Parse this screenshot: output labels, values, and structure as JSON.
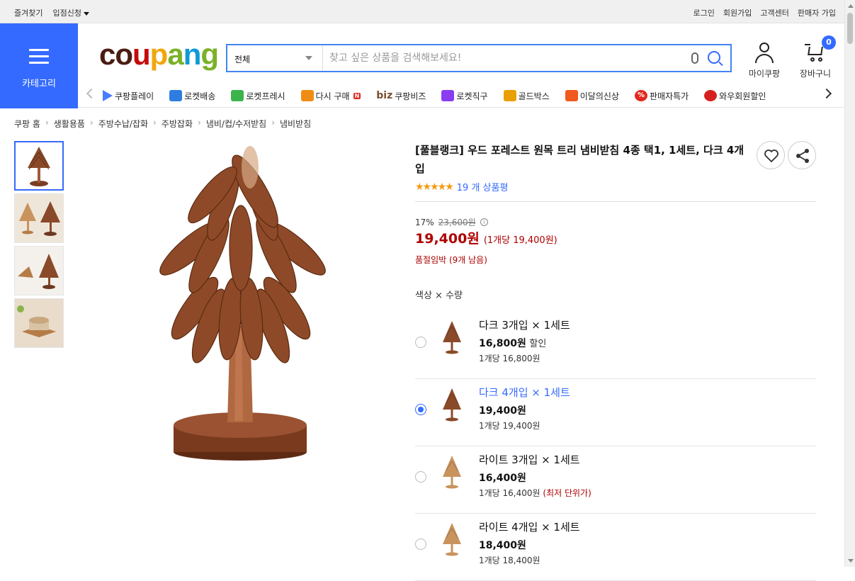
{
  "topbar": {
    "favorites": "즐겨찾기",
    "seller_apply": "입점신청",
    "login": "로그인",
    "signup": "회원가입",
    "customer_center": "고객센터",
    "seller_signup": "판매자 가입"
  },
  "category": {
    "label": "카테고리"
  },
  "logo": {
    "text": "coupang",
    "colors": [
      "#4a1d12",
      "#c60a0a",
      "#f2a60d",
      "#7bb128",
      "#0f9ad6"
    ]
  },
  "search": {
    "category_value": "전체",
    "placeholder": "찾고 싶은 상품을 검색해보세요!"
  },
  "header_icons": {
    "my_coupang": "마이쿠팡",
    "cart": "장바구니",
    "cart_count": "0"
  },
  "nav": {
    "items": [
      {
        "label": "쿠팡플레이",
        "icon": "play-icon",
        "color": "#4b7bff"
      },
      {
        "label": "로켓배송",
        "icon": "rocket-icon",
        "color": "#2f7de1"
      },
      {
        "label": "로켓프레시",
        "icon": "rocket-fresh-icon",
        "color": "#3cb44b"
      },
      {
        "label": "다시 구매",
        "icon": "basket-icon",
        "color": "#f08c14"
      },
      {
        "label": "쿠팡비즈",
        "icon": "biz-icon",
        "color": "#7a5030"
      },
      {
        "label": "로켓직구",
        "icon": "rocket-global-icon",
        "color": "#8a3df0"
      },
      {
        "label": "골드박스",
        "icon": "goldbox-icon",
        "color": "#e8a000"
      },
      {
        "label": "이달의신상",
        "icon": "new-bag-icon",
        "color": "#f05a1e"
      },
      {
        "label": "판매자특가",
        "icon": "percent-icon",
        "color": "#e0281e"
      },
      {
        "label": "와우회원할인",
        "icon": "wow-icon",
        "color": "#d62020"
      }
    ],
    "biz_prefix": "biz",
    "new_badge": "N"
  },
  "breadcrumb": [
    "쿠팡 홈",
    "생활용품",
    "주방수납/잡화",
    "주방잡화",
    "냄비/컵/수저받침",
    "냄비받침"
  ],
  "product": {
    "title": "[풀블랭크] 우드 포레스트 원목 트리 냄비받침 4종 택1, 1세트, 다크 4개입",
    "rating_stars": "★★★★★",
    "review_count": "19 개 상품평",
    "discount_rate": "17%",
    "original_price": "23,600원",
    "price": "19,400원",
    "unit_price": "(1개당 19,400원)",
    "stock_note": "품절임박 (9개 남음)",
    "option_label": "색상 × 수량",
    "options": [
      {
        "name": "다크 3개입 × 1세트",
        "price": "16,800원",
        "discount_text": "할인",
        "unit": "1개당 16,800원",
        "selected": false,
        "tone": "dark"
      },
      {
        "name": "다크 4개입 × 1세트",
        "price": "19,400원",
        "discount_text": "",
        "unit": "1개당 19,400원",
        "selected": true,
        "tone": "dark"
      },
      {
        "name": "라이트 3개입 × 1세트",
        "price": "16,400원",
        "discount_text": "",
        "unit": "1개당 16,400원",
        "lowest": "(최저 단위가)",
        "selected": false,
        "tone": "light"
      },
      {
        "name": "라이트 4개입 × 1세트",
        "price": "18,400원",
        "discount_text": "",
        "unit": "1개당 18,400원",
        "selected": false,
        "tone": "light"
      }
    ]
  },
  "colors": {
    "accent": "#346aff",
    "price_red": "#ae0000",
    "star": "#f59a14",
    "wood_dark": "#8a4a2a",
    "wood_light": "#c9935e"
  }
}
